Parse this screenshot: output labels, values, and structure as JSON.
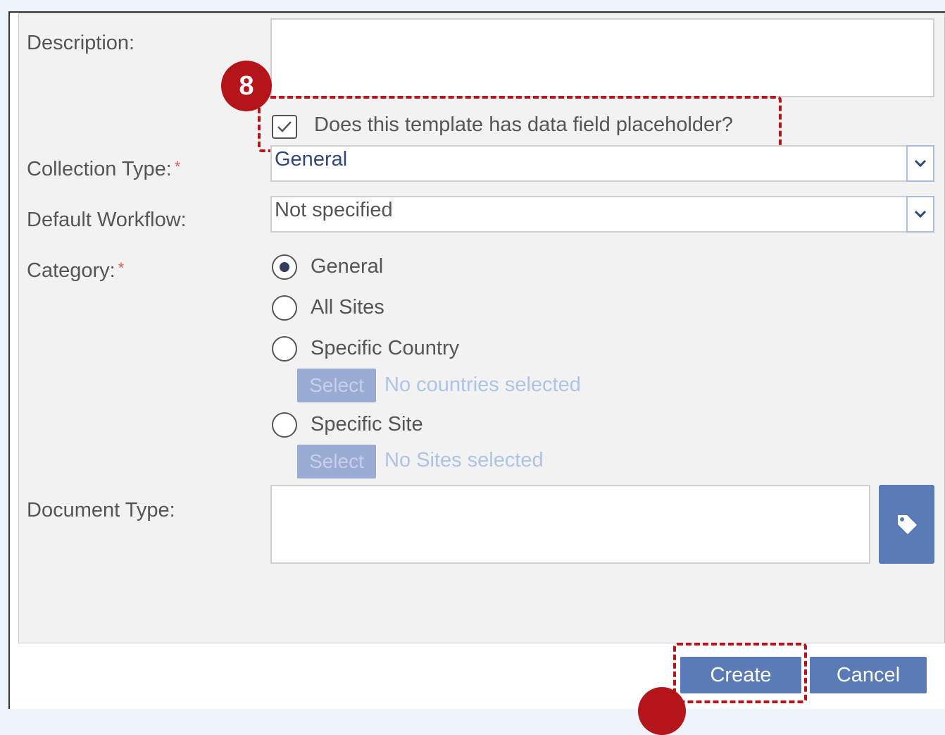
{
  "form": {
    "description_label": "Description:",
    "placeholder_checkbox_label": "Does this template has data field placeholder?",
    "placeholder_checked": true,
    "collection_type_label": "Collection Type:",
    "collection_type_value": "General",
    "default_workflow_label": "Default Workflow:",
    "default_workflow_value": "Not specified",
    "category_label": "Category:",
    "required_mark": "*",
    "category_options": [
      "General",
      "All Sites",
      "Specific Country",
      "Specific Site"
    ],
    "category_selected": "General",
    "select_label": "Select",
    "no_countries": "No countries selected",
    "no_sites": "No Sites selected",
    "document_type_label": "Document Type:"
  },
  "buttons": {
    "create": "Create",
    "cancel": "Cancel"
  },
  "annotations": {
    "step_8": "8"
  },
  "colors": {
    "accent": "#5a7bb5",
    "highlight": "#b3151a",
    "required": "#e05a5a"
  },
  "icons": {
    "dropdown": "chevron-down-icon",
    "tag": "tag-icon",
    "check": "check-icon"
  }
}
